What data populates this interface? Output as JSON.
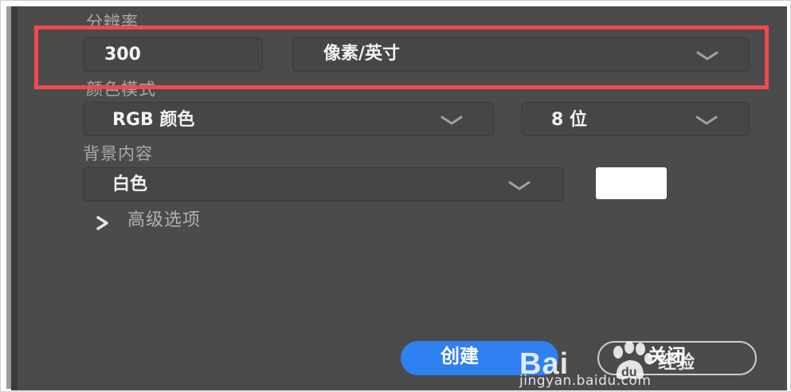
{
  "labels": {
    "resolution": "分辨率",
    "color_mode": "颜色模式",
    "background": "背景内容"
  },
  "resolution": {
    "value": "300",
    "unit": "像素/英寸"
  },
  "color_mode": {
    "mode": "RGB 颜色",
    "bit_depth": "8 位"
  },
  "background": {
    "value": "白色",
    "swatch_color": "#ffffff"
  },
  "advanced": {
    "label": "高级选项"
  },
  "buttons": {
    "create": "创建",
    "close": "关闭"
  },
  "watermark": {
    "logo": "Bai",
    "logo_mark": "du",
    "subtitle": "经验",
    "url": "jingyan.baidu.com"
  },
  "colors": {
    "panel": "#4b4b4b",
    "field": "#464646",
    "highlight": "#ee4a50",
    "primary": "#2f80f0"
  },
  "icons": [
    "chevron-down-icon",
    "chevron-right-icon",
    "paw-icon"
  ]
}
